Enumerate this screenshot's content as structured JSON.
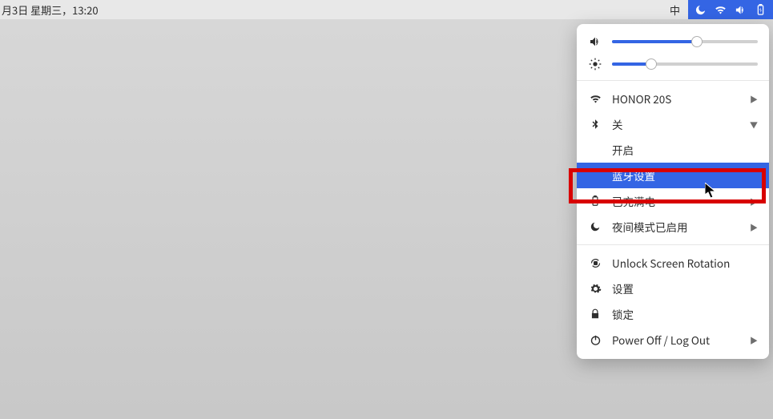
{
  "topbar": {
    "datetime": "月3日 星期三，13:20",
    "ime": "中"
  },
  "sliders": {
    "volume_percent": 58,
    "brightness_percent": 27
  },
  "menu": {
    "wifi": "HONOR 20S",
    "bluetooth": "关",
    "bluetooth_on": "开启",
    "bluetooth_settings": "蓝牙设置",
    "power": "已充满电",
    "night_mode": "夜间模式已启用",
    "rotation": "Unlock Screen Rotation",
    "settings": "设置",
    "lock": "锁定",
    "power_off": "Power Off / Log Out"
  }
}
